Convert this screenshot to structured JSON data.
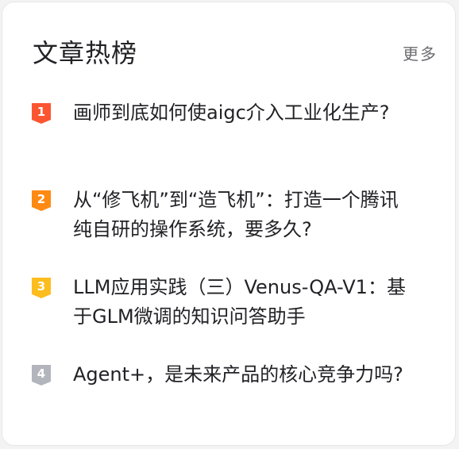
{
  "header": {
    "title": "文章热榜",
    "more_label": "更多"
  },
  "items": [
    {
      "rank": "1",
      "color": "#fc5531",
      "title": "画师到底如何使aigc介入工业化生产?"
    },
    {
      "rank": "2",
      "color": "#fe8a13",
      "title": "从“修飞机”到“造飞机”：打造一个腾讯纯自研的操作系统，要多久?"
    },
    {
      "rank": "3",
      "color": "#fdbd1e",
      "title": "LLM应用实践（三）Venus-QA-V1：基于GLM微调的知识问答助手"
    },
    {
      "rank": "4",
      "color": "#b3b5bd",
      "title": "Agent+，是未来产品的核心竞争力吗?"
    }
  ]
}
